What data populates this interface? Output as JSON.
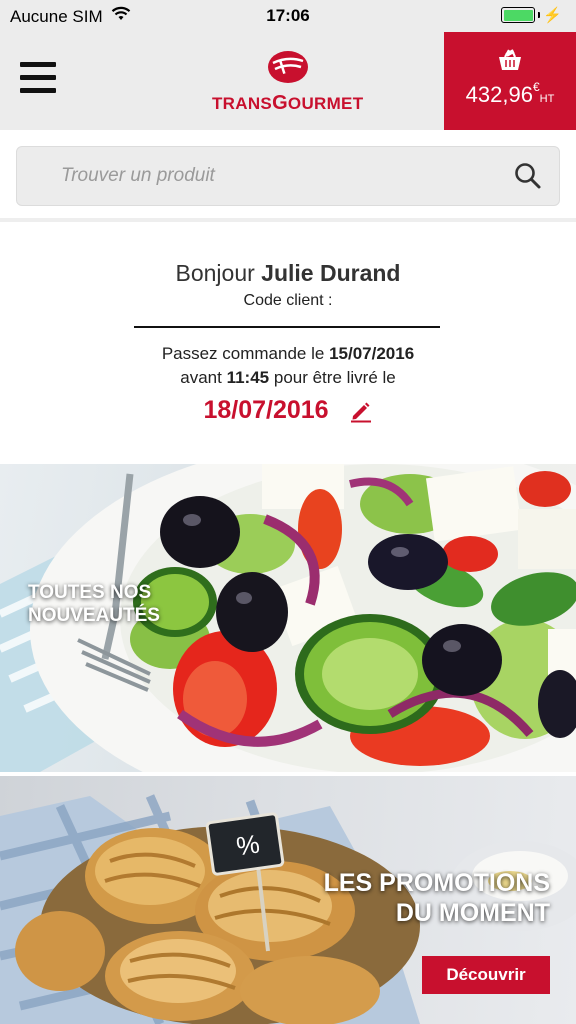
{
  "status_bar": {
    "carrier": "Aucune SIM",
    "time": "17:06",
    "wifi_icon": "wifi-icon",
    "battery_icon": "battery-charging-icon"
  },
  "header": {
    "menu_icon": "hamburger-menu-icon",
    "logo_text_prefix": "TRANS",
    "logo_text_big": "G",
    "logo_text_rest": "OURMET",
    "cart": {
      "icon": "basket-icon",
      "amount": "432,96",
      "currency": "€",
      "tax_label": "HT"
    }
  },
  "search": {
    "placeholder": "Trouver un produit",
    "icon": "search-icon"
  },
  "greeting": {
    "hello": "Bonjour",
    "name": "Julie Durand",
    "client_code_label": "Code client :",
    "order_prefix": "Passez commande le",
    "order_date": "15/07/2016",
    "before_label": "avant",
    "deadline_time": "11:45",
    "delivery_label": "pour être livré le",
    "delivery_date": "18/07/2016",
    "edit_icon": "pencil-edit-icon"
  },
  "banners": {
    "new_products": {
      "line1": "TOUTES NOS",
      "line2": "NOUVEAUTÉS"
    },
    "promotions": {
      "line1": "LES PROMOTIONS",
      "line2": "DU MOMENT",
      "sign_text": "%",
      "button": "Découvrir"
    }
  },
  "colors": {
    "brand_red": "#c8102e",
    "header_bg": "#ececec"
  }
}
